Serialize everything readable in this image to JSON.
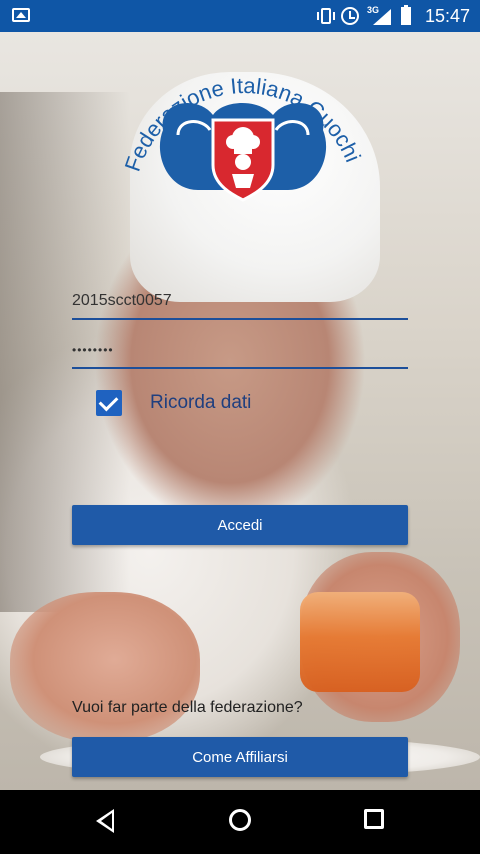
{
  "status_bar": {
    "network_type": "3G",
    "time": "15:47",
    "icons": [
      "image-icon",
      "vibrate-icon",
      "alarm-icon",
      "signal-icon",
      "battery-icon"
    ]
  },
  "logo": {
    "text": "Federazione Italiana Cuochi",
    "accent_color": "#d8282f",
    "brand_color": "#1d5fa8"
  },
  "login": {
    "username_value": "2015scct0057",
    "password_mask": "••••••••",
    "remember_label": "Ricorda dati",
    "remember_checked": true,
    "login_button": "Accedi"
  },
  "join": {
    "question": "Vuoi far parte della federazione?",
    "button": "Come Affiliarsi"
  },
  "nav_bar": {
    "icons": [
      "back-icon",
      "home-icon",
      "recents-icon"
    ]
  },
  "colors": {
    "status_bar": "#0f56a6",
    "button": "#1f5aa8",
    "field_underline": "#1d4f9a",
    "checkbox": "#1f62c0"
  }
}
